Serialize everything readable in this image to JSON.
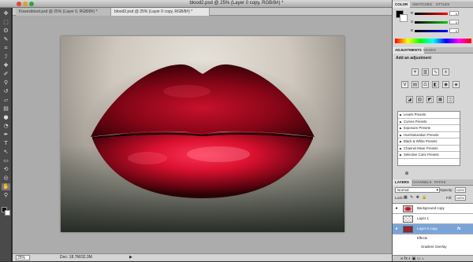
{
  "window": {
    "title": "blood2.psd @ 25% (Layer 0 copy, RGB/8#) *"
  },
  "tabs": [
    {
      "label": "Kissesblood.psd @ 25% (Layer 0, RGB/8#) *"
    },
    {
      "label": "blood2.psd @ 25% (Layer 0 copy, RGB/8#) *"
    }
  ],
  "status": {
    "zoom": "25%",
    "doc_size": "Doc: 18.7M/32.3M",
    "arrow": "▶"
  },
  "color_panel": {
    "tabs": [
      "COLOR",
      "SWATCHES",
      "STYLES"
    ],
    "sliders": [
      {
        "label": "R",
        "value": "0",
        "color": "#ff0000"
      },
      {
        "label": "G",
        "value": "0",
        "color": "#00cc00"
      },
      {
        "label": "B",
        "value": "0",
        "color": "#0000ff"
      }
    ]
  },
  "adjustments": {
    "tabs": [
      "ADJUSTMENTS",
      "MASKS"
    ],
    "title": "Add an adjustment",
    "presets": [
      "Levels Presets",
      "Curves Presets",
      "Exposure Presets",
      "Hue/Saturation Presets",
      "Black & White Presets",
      "Channel Mixer Presets",
      "Selective Color Presets"
    ]
  },
  "layers": {
    "tabs": [
      "LAYERS",
      "CHANNELS",
      "PATHS"
    ],
    "blend_mode": "Normal",
    "opacity_label": "Opacity:",
    "opacity": "100%",
    "lock_label": "Lock:",
    "fill_label": "Fill:",
    "fill": "100%",
    "items": [
      {
        "name": "Background copy"
      },
      {
        "name": "Layer 1"
      },
      {
        "name": "Layer 0 copy",
        "fx": "fx"
      }
    ],
    "effects_label": "Effects",
    "gradient_overlay_label": "Gradient Overlay",
    "footer_icons": "∞ fx ◐ ▣ ▭ ⌂"
  }
}
